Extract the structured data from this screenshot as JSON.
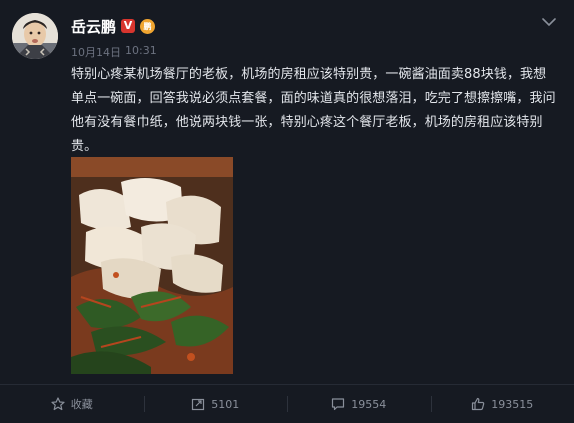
{
  "author": {
    "name": "岳云鹏",
    "verified_badge": "V",
    "level_badge": "鹏"
  },
  "meta": {
    "date": "10月14日",
    "time": "10:31"
  },
  "post": {
    "text": "特别心疼某机场餐厅的老板，机场的房租应该特别贵，一碗酱油面卖88块钱，我想单点一碗面，回答我说必须点套餐，面的味道真的很想落泪，吃完了想擦擦嘴，我问他有没有餐巾纸，他说两块钱一张，特别心疼这个餐厅老板，机场的房租应该特别贵。"
  },
  "actions": {
    "favorite_label": "收藏",
    "repost_count": "5101",
    "comment_count": "19554",
    "like_count": "193515"
  },
  "icons": {
    "menu": "chevron-down-icon",
    "favorite": "star-icon",
    "repost": "repost-icon",
    "comment": "comment-icon",
    "like": "thumbs-up-icon"
  },
  "colors": {
    "background": "#161a22",
    "verified_badge": "#d8352e",
    "level_badge": "#f0a530",
    "text": "#e3e6eb",
    "muted": "#8a909b"
  }
}
